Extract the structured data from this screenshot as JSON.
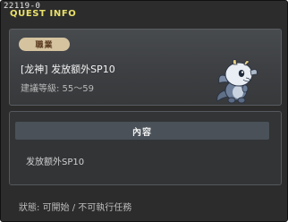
{
  "window": {
    "id_code": "22119-0",
    "title": "QUEST INFO"
  },
  "quest": {
    "job_badge": "職業",
    "name": "[龙神] 发放额外SP10",
    "recommended_level": "建議等級: 55～59",
    "npc_icon": "baby-dragon-icon"
  },
  "content": {
    "header": "內容",
    "text": "发放额外SP10"
  },
  "footer": {
    "status": "狀態: 可開始 / 不可執行任務"
  },
  "colors": {
    "title": "#e9e06a",
    "badge_bg": "#d5c3a0",
    "panel_bg": "#3c3e41",
    "window_bg": "#2c2c2c"
  }
}
